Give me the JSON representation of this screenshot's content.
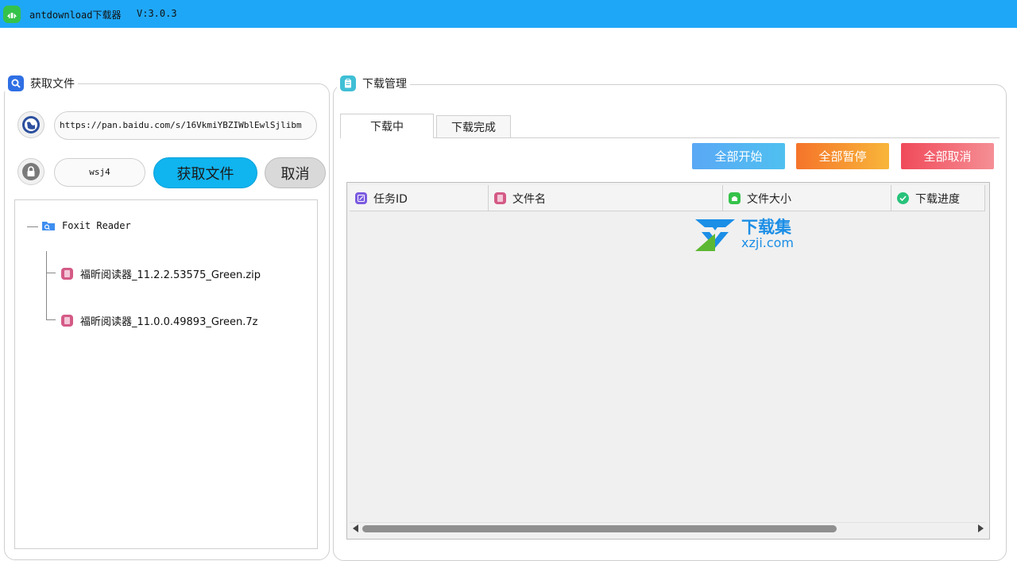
{
  "titlebar": {
    "title": "antdownload下载器",
    "version": "V:3.0.3"
  },
  "left_panel": {
    "legend": "获取文件",
    "url_value": "https://pan.baidu.com/s/16VkmiYBZIWblEwlSjlibm",
    "password_value": "wsj4",
    "fetch_button": "获取文件",
    "cancel_button": "取消",
    "tree": {
      "root": "Foxit Reader",
      "children": [
        "福昕阅读器_11.2.2.53575_Green.zip",
        "福昕阅读器_11.0.0.49893_Green.7z"
      ]
    }
  },
  "right_panel": {
    "legend": "下载管理",
    "tabs": [
      "下载中",
      "下载完成"
    ],
    "active_tab": "下载中",
    "actions": {
      "start_all": "全部开始",
      "pause_all": "全部暂停",
      "cancel_all": "全部取消"
    },
    "columns": [
      "任务ID",
      "文件名",
      "文件大小",
      "下载进度"
    ]
  },
  "watermark": {
    "top": "下载集",
    "bottom": "xzji.com"
  },
  "colors": {
    "titlebar": "#1fa7f7",
    "fetch_button": "#10b4ef",
    "start_all": "#5aa8f5",
    "pause_all": "#f5742a",
    "cancel_all": "#f04a5a"
  },
  "icons": {
    "app": "ant-app-icon",
    "fetch_legend": "search-icon",
    "download_legend": "clipboard-icon",
    "url": "globe-icon",
    "password": "lock-icon",
    "folder": "folder-search-icon",
    "file": "file-icon"
  }
}
